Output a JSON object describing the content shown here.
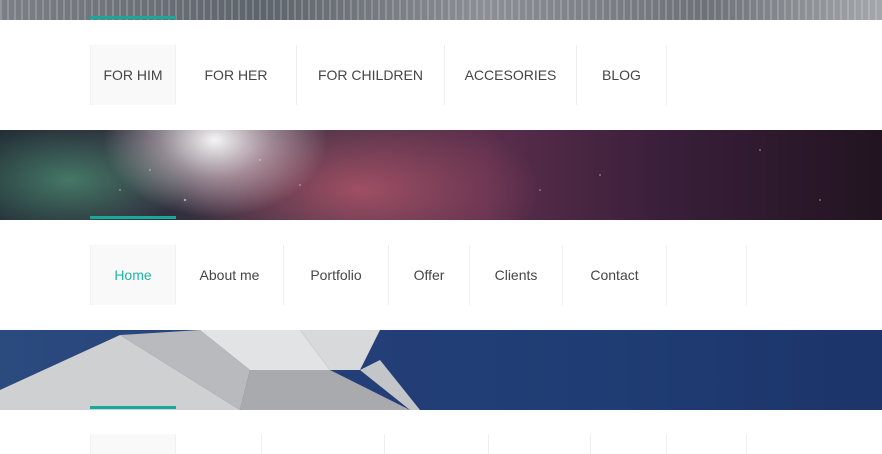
{
  "nav_top": {
    "items": [
      {
        "label": "FOR HIM"
      },
      {
        "label": "FOR HER"
      },
      {
        "label": "FOR CHILDREN"
      },
      {
        "label": "ACCESORIES"
      },
      {
        "label": "BLOG"
      }
    ]
  },
  "nav_mid": {
    "items": [
      {
        "label": "Home",
        "active": true
      },
      {
        "label": "About me"
      },
      {
        "label": "Portfolio"
      },
      {
        "label": "Offer"
      },
      {
        "label": "Clients"
      },
      {
        "label": "Contact"
      }
    ]
  },
  "colors": {
    "accent": "#19a99b",
    "active_text": "#21b5a6",
    "nav_text": "#454545",
    "divider": "#efefef"
  }
}
